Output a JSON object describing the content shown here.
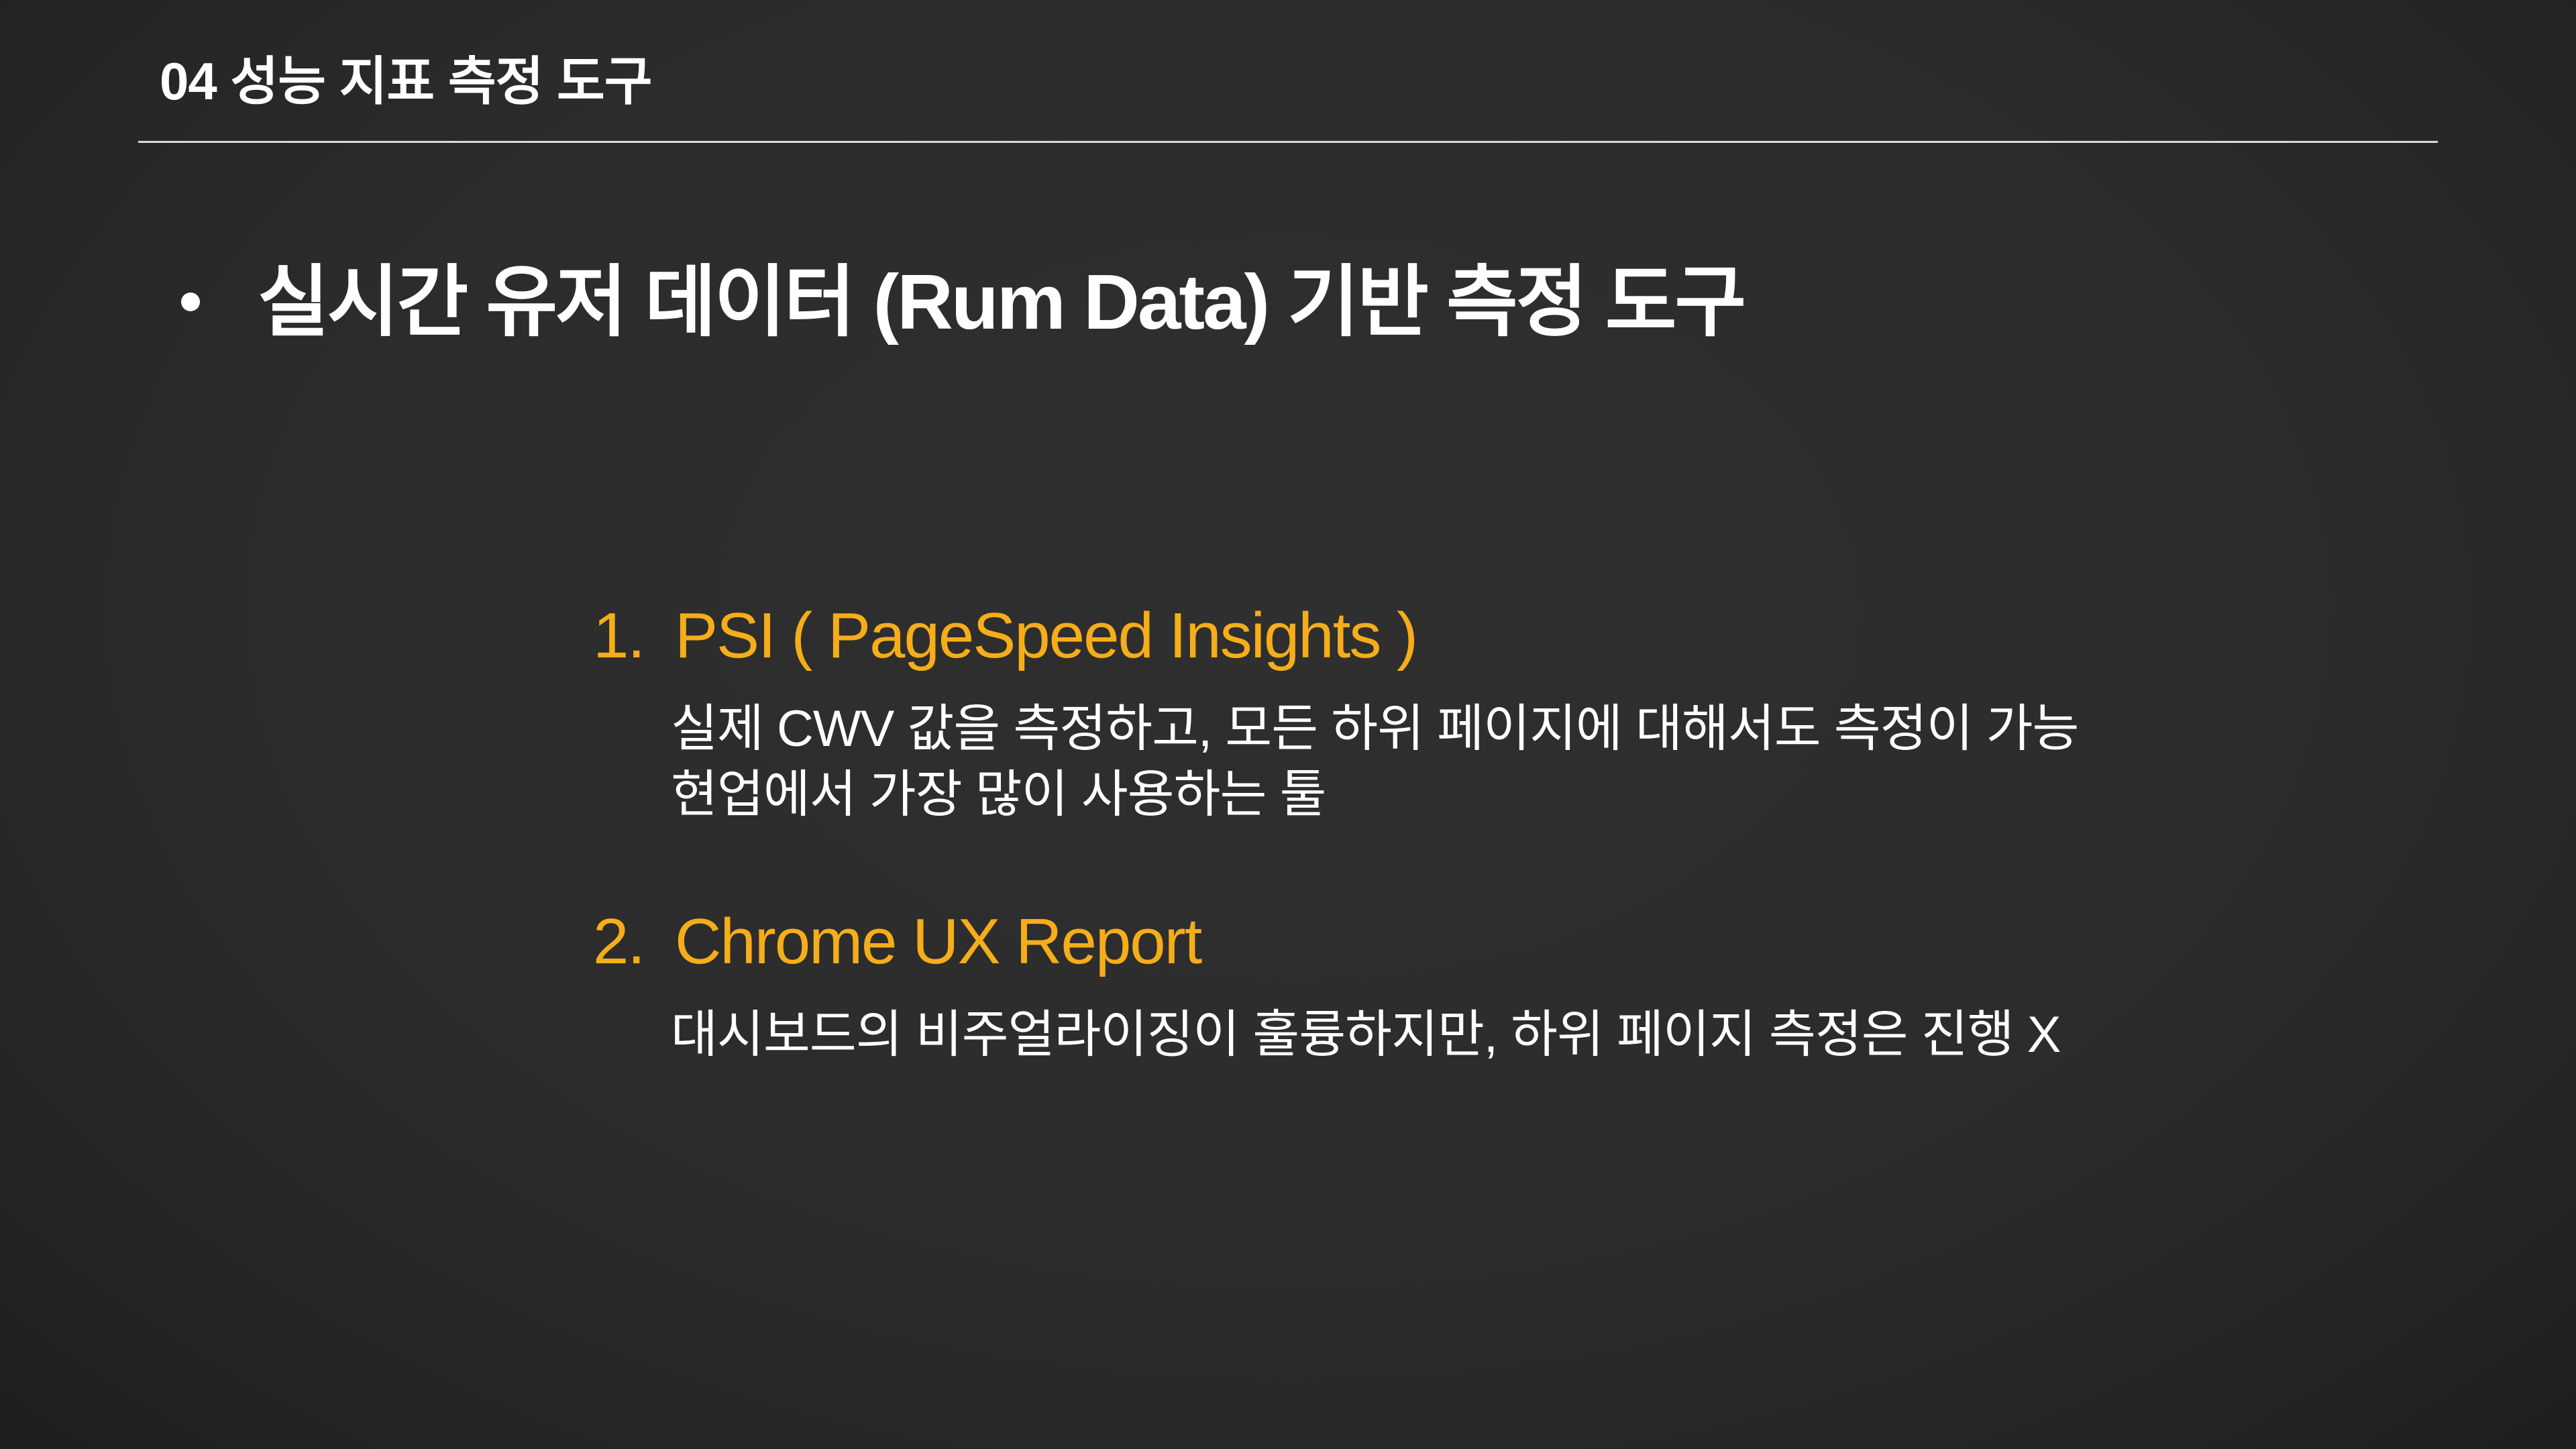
{
  "header": {
    "title": "04 성능 지표 측정 도구"
  },
  "main": {
    "bullet": "실시간 유저 데이터 (Rum Data) 기반 측정 도구",
    "items": [
      {
        "number": "1.",
        "title": "PSI ( PageSpeed Insights )",
        "lines": [
          "실제 CWV 값을 측정하고, 모든 하위 페이지에 대해서도 측정이 가능",
          "현업에서 가장 많이 사용하는 툴"
        ]
      },
      {
        "number": "2.",
        "title": "Chrome UX Report",
        "lines": [
          "대시보드의 비주얼라이징이 훌륭하지만, 하위 페이지 측정은 진행 X"
        ]
      }
    ]
  },
  "colors": {
    "background": "#2c2c2c",
    "accent": "#f5ad19",
    "text": "#ffffff",
    "rule": "#d9d9d9"
  }
}
